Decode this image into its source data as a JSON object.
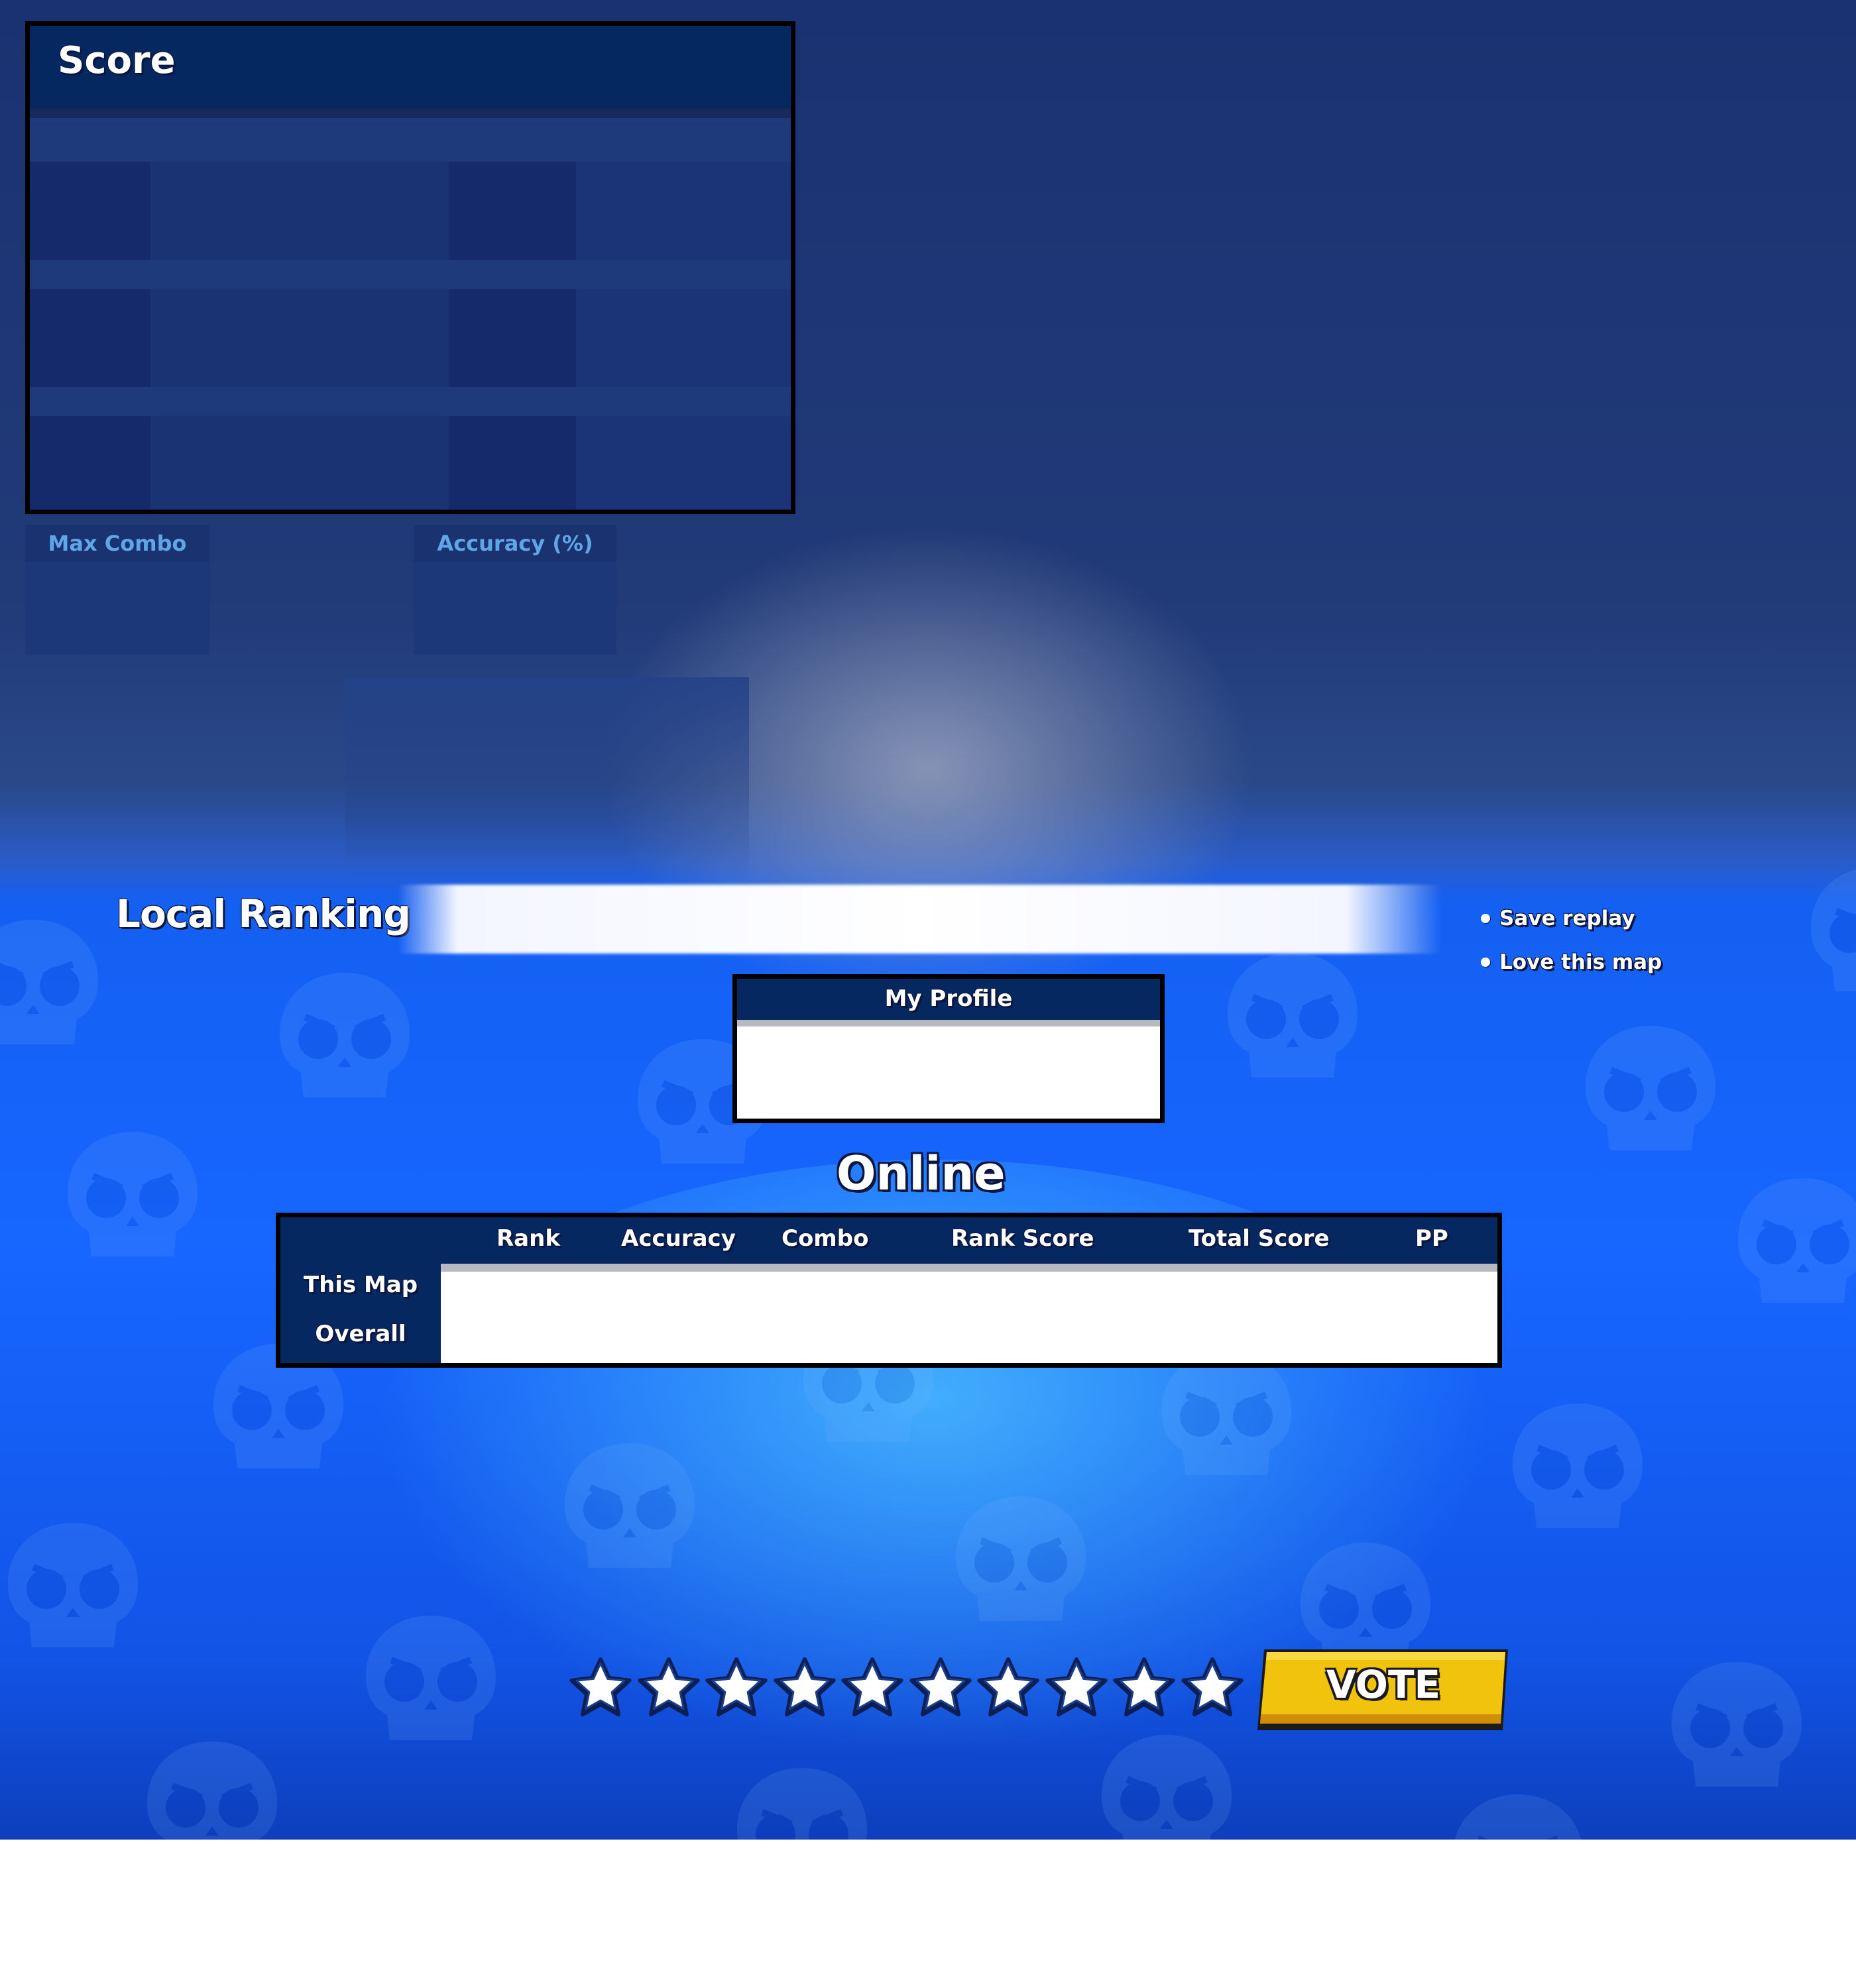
{
  "score_panel": {
    "title": "Score"
  },
  "stats": {
    "max_combo_label": "Max Combo",
    "accuracy_label": "Accuracy (%)"
  },
  "local_ranking": {
    "title": "Local Ranking"
  },
  "options": {
    "save_replay": "Save replay",
    "love_map": "Love this map"
  },
  "profile": {
    "title": "My Profile"
  },
  "online": {
    "title": "Online",
    "columns": [
      "Rank",
      "Accuracy",
      "Combo",
      "Rank Score",
      "Total Score",
      "PP"
    ],
    "rows": [
      "This Map",
      "Overall"
    ]
  },
  "rating": {
    "star_count": 10,
    "vote_label": "VOTE"
  },
  "colors": {
    "panel_header": "#062860",
    "accent_blue": "#1766ff",
    "vote_yellow": "#f2c30c",
    "stat_label": "#5fa6e6"
  },
  "icons": {
    "background": "skull-icon",
    "rating": "star-icon"
  }
}
